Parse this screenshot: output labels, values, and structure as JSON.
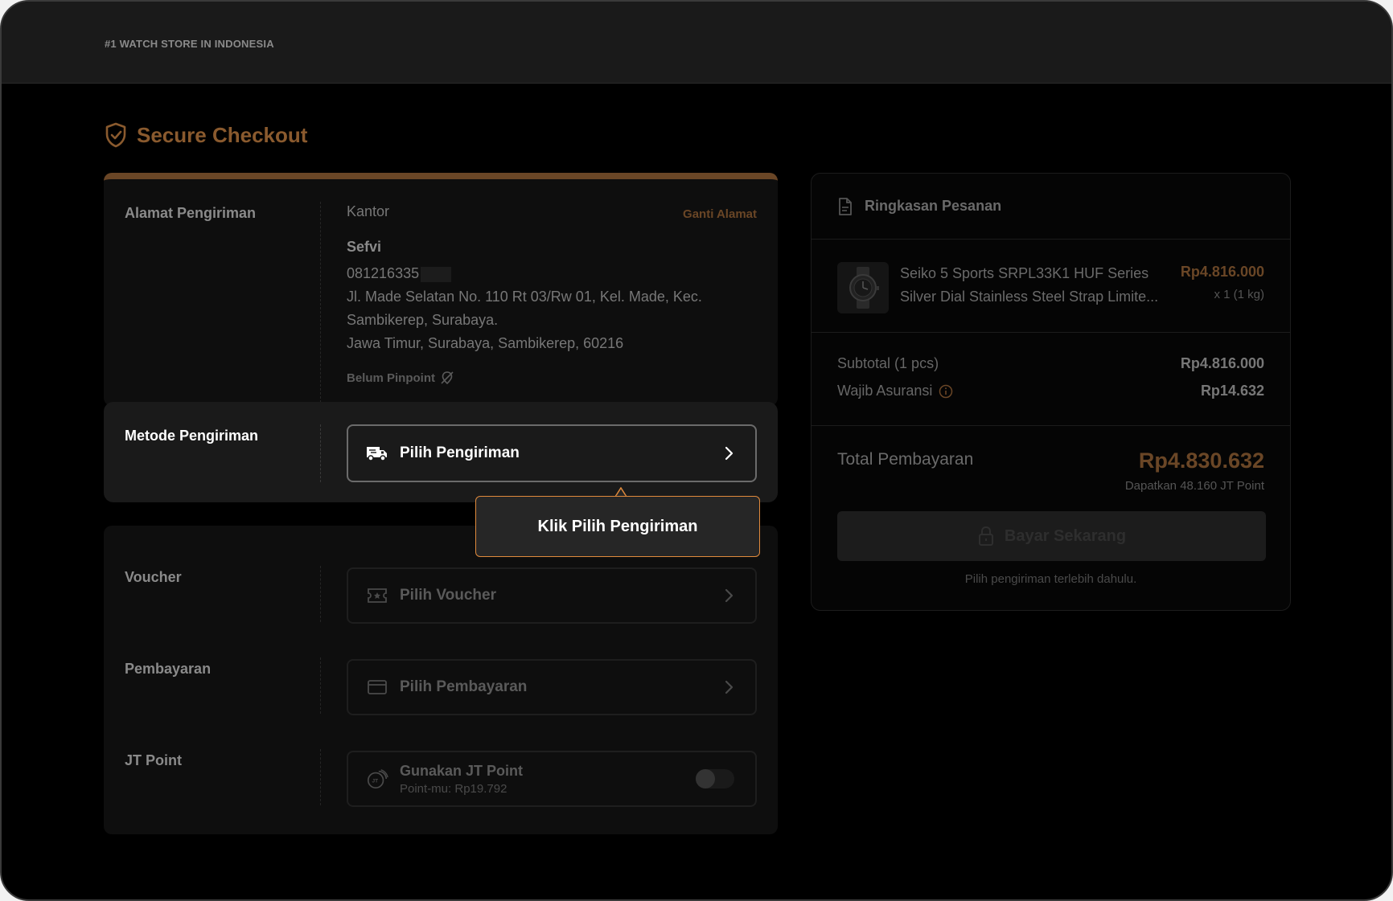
{
  "header": {
    "tagline": "#1 WATCH STORE IN INDONESIA"
  },
  "page": {
    "title": "Secure Checkout"
  },
  "address": {
    "label": "Alamat Pengiriman",
    "type": "Kantor",
    "change_link": "Ganti Alamat",
    "name": "Sefvi",
    "phone": "081216335",
    "line1": "Jl. Made Selatan No. 110 Rt 03/Rw 01, Kel. Made, Kec.",
    "line2": "Sambikerep, Surabaya.",
    "line3": "Jawa Timur, Surabaya, Sambikerep, 60216",
    "pinpoint": "Belum Pinpoint"
  },
  "shipping": {
    "label": "Metode Pengiriman",
    "select": "Pilih Pengiriman"
  },
  "tooltip": {
    "text": "Klik Pilih Pengiriman"
  },
  "voucher": {
    "label": "Voucher",
    "select": "Pilih Voucher"
  },
  "payment": {
    "label": "Pembayaran",
    "select": "Pilih Pembayaran"
  },
  "jtpoint": {
    "label": "JT Point",
    "title": "Gunakan JT Point",
    "subtitle": "Point-mu: Rp19.792"
  },
  "summary": {
    "title": "Ringkasan Pesanan",
    "product": {
      "name_line1": "Seiko 5 Sports SRPL33K1 HUF Series",
      "name_line2": "Silver Dial Stainless Steel Strap Limite...",
      "price": "Rp4.816.000",
      "qty": "x 1 (1 kg)"
    },
    "subtotal_label": "Subtotal (1 pcs)",
    "subtotal_value": "Rp4.816.000",
    "insurance_label": "Wajib Asuransi",
    "insurance_value": "Rp14.632",
    "total_label": "Total Pembayaran",
    "total_value": "Rp4.830.632",
    "points_earn": "Dapatkan 48.160 JT Point",
    "pay_button": "Bayar Sekarang",
    "pay_hint": "Pilih pengiriman terlebih dahulu."
  },
  "colors": {
    "accent": "#e08a3c",
    "accent_dim": "#6a4626",
    "background": "#000000"
  }
}
